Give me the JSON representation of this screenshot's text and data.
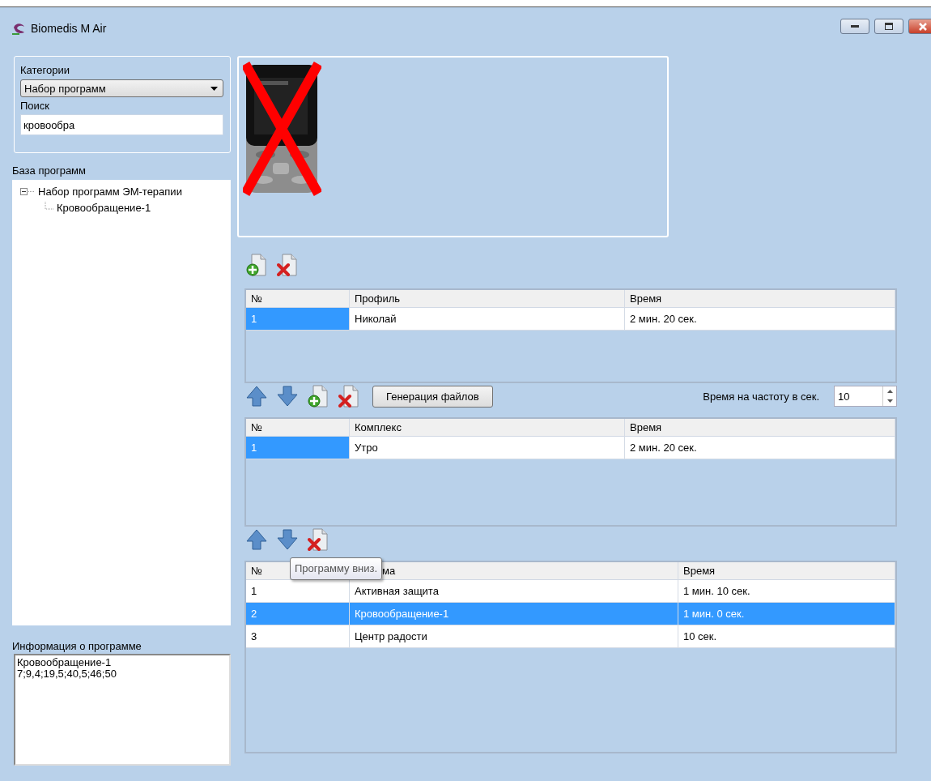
{
  "window": {
    "title": "Biomedis M Air"
  },
  "categories": {
    "label": "Категории",
    "value": "Набор программ"
  },
  "search": {
    "label": "Поиск",
    "value": "кровообра"
  },
  "program_base": {
    "label": "База программ",
    "tree": [
      {
        "label": "Набор программ ЭМ-терапии",
        "expanded": true,
        "children": [
          {
            "label": "Кровообращение-1"
          }
        ]
      }
    ]
  },
  "program_info": {
    "label": "Информация о программе",
    "value": "Кровообращение-1\n7;9,4;19,5;40,5;46;50"
  },
  "toolbar_1": [
    {
      "kind": "add"
    },
    {
      "kind": "delete"
    }
  ],
  "toolbar_2": [
    {
      "kind": "up"
    },
    {
      "kind": "down"
    },
    {
      "kind": "add"
    },
    {
      "kind": "delete"
    },
    {
      "kind": "button",
      "label": "Генерация файлов"
    }
  ],
  "frequency_time": {
    "label": "Время на частоту в сек.",
    "value": "10"
  },
  "toolbar_3": [
    {
      "kind": "up"
    },
    {
      "kind": "down"
    },
    {
      "kind": "delete"
    }
  ],
  "tables": [
    {
      "full_row_select": false,
      "columns": [
        {
          "label": "№"
        },
        {
          "label": "Профиль"
        },
        {
          "label": "Время"
        }
      ],
      "rows": [
        {
          "selected": true,
          "cells": [
            "1",
            "Николай",
            "2 мин. 20 сек."
          ]
        }
      ]
    },
    {
      "full_row_select": false,
      "columns": [
        {
          "label": "№"
        },
        {
          "label": "Комплекс"
        },
        {
          "label": "Время"
        }
      ],
      "rows": [
        {
          "selected": true,
          "cells": [
            "1",
            "Утро",
            "2 мин. 20 сек."
          ]
        }
      ]
    },
    {
      "full_row_select": true,
      "tooltip": "Программу вниз.",
      "columns": [
        {
          "label": "№"
        },
        {
          "label": "ма",
          "obscured": true
        },
        {
          "label": "Время"
        }
      ],
      "rows": [
        {
          "selected": false,
          "cells": [
            "1",
            "Активная защита",
            "1 мин. 10 сек."
          ]
        },
        {
          "selected": true,
          "cells": [
            "2",
            "Кровообращение-1",
            "1 мин. 0 сек."
          ]
        },
        {
          "selected": false,
          "cells": [
            "3",
            "Центр радости",
            "10 сек."
          ]
        }
      ]
    }
  ]
}
